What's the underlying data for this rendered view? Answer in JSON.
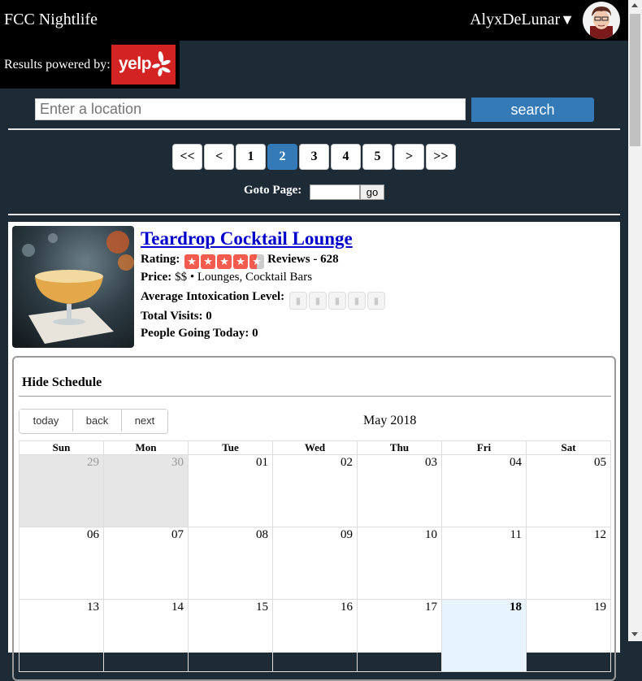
{
  "header": {
    "app_title": "FCC Nightlife",
    "username": "AlyxDeLunar",
    "caret": "▼"
  },
  "powered": {
    "label": "Results powered by:",
    "logo_text": "yelp"
  },
  "search": {
    "placeholder": "Enter a location",
    "value": "",
    "button_label": "search"
  },
  "pagination": {
    "pages": [
      "<<",
      "<",
      "1",
      "2",
      "3",
      "4",
      "5",
      ">",
      ">>"
    ],
    "active_page": "2",
    "goto_label": "Goto Page:",
    "goto_button": "go"
  },
  "business": {
    "name": "Teardrop Cocktail Lounge",
    "rating_label": "Rating:",
    "rating": 4.5,
    "reviews_text": "Reviews - 628",
    "price_label": "Price:",
    "price_value": "$$ • Lounges, Cocktail Bars",
    "intoxication_label": "Average Intoxication Level:",
    "intoxication_level": 0,
    "intoxication_max": 5,
    "visits_label": "Total Visits:",
    "visits_value": "0",
    "going_label": "People Going Today:",
    "going_value": "0"
  },
  "schedule": {
    "toggle_label": "Hide Schedule",
    "buttons": [
      "today",
      "back",
      "next"
    ],
    "month_title": "May 2018",
    "weekdays": [
      "Sun",
      "Mon",
      "Tue",
      "Wed",
      "Thu",
      "Fri",
      "Sat"
    ],
    "weeks": [
      [
        "29",
        "30",
        "01",
        "02",
        "03",
        "04",
        "05"
      ],
      [
        "06",
        "07",
        "08",
        "09",
        "10",
        "11",
        "12"
      ],
      [
        "13",
        "14",
        "15",
        "16",
        "17",
        "18",
        "19"
      ]
    ],
    "other_month_days": [
      "29",
      "30"
    ],
    "today": "18"
  },
  "colors": {
    "background": "#1c2b36",
    "primary": "#337ab7",
    "yelp_red": "#d32323",
    "star_red": "#f15c4f",
    "link": "#0000cc"
  }
}
